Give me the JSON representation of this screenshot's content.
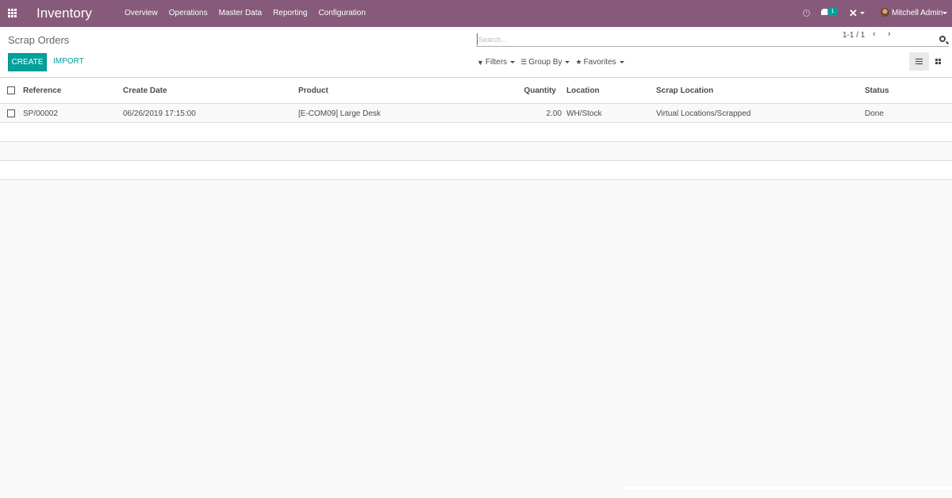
{
  "navbar": {
    "app_title": "Inventory",
    "menu": [
      "Overview",
      "Operations",
      "Master Data",
      "Reporting",
      "Configuration"
    ],
    "chat_badge": "1",
    "user_name": "Mitchell Admin",
    "icons": [
      "apps-grid-icon",
      "clock-icon",
      "chat-icon",
      "tools-icon",
      "avatar"
    ]
  },
  "control_panel": {
    "breadcrumb": "Scrap Orders",
    "create_label": "CREATE",
    "import_label": "IMPORT",
    "search_placeholder": "Search...",
    "filters_label": "Filters",
    "group_by_label": "Group By",
    "favorites_label": "Favorites",
    "pager": "1-1 / 1",
    "view_active": "list"
  },
  "table": {
    "headers": [
      "Reference",
      "Create Date",
      "Product",
      "Quantity",
      "Location",
      "Scrap Location",
      "Status"
    ],
    "rows": [
      {
        "reference": "SP/00002",
        "create_date": "06/26/2019 17:15:00",
        "product": "[E-COM09] Large Desk",
        "quantity": "2.00",
        "location": "WH/Stock",
        "scrap_location": "Virtual Locations/Scrapped",
        "status": "Done"
      }
    ]
  },
  "colors": {
    "navbar": "#875a7b",
    "primary": "#00a09d"
  }
}
